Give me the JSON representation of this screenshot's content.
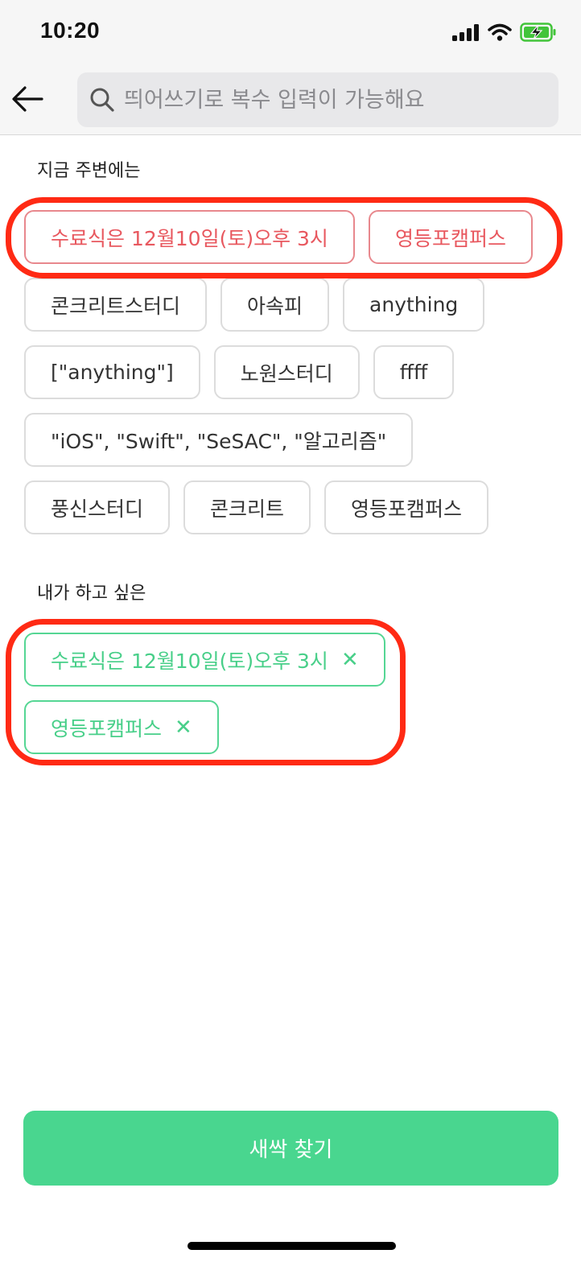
{
  "status_bar": {
    "time": "10:20",
    "icons": [
      "signal-icon",
      "wifi-icon",
      "battery-charging-icon"
    ],
    "battery_color": "#42c43a"
  },
  "nav": {
    "back_icon": "arrow-left-icon",
    "search_icon": "search-icon",
    "search_placeholder": "띄어쓰기로 복수 입력이 가능해요",
    "search_value": ""
  },
  "nearby": {
    "title": "지금 주변에는",
    "recommended": [
      {
        "label": "수료식은 12월10일(토)오후 3시"
      },
      {
        "label": "영등포캠퍼스"
      }
    ],
    "rows": [
      [
        {
          "label": "콘크리트스터디"
        },
        {
          "label": "아속피"
        },
        {
          "label": "anything"
        }
      ],
      [
        {
          "label": "[\"anything\"]"
        },
        {
          "label": "노원스터디"
        },
        {
          "label": "ffff"
        }
      ],
      [
        {
          "label": "\"iOS\", \"Swift\", \"SeSAC\", \"알고리즘\""
        }
      ],
      [
        {
          "label": "풍신스터디"
        },
        {
          "label": "콘크리트"
        },
        {
          "label": "영등포캠퍼스"
        }
      ]
    ]
  },
  "wanted": {
    "title": "내가 하고 싶은",
    "remove_symbol": "✕",
    "items": [
      {
        "label": "수료식은 12월10일(토)오후 3시"
      },
      {
        "label": "영등포캠퍼스"
      }
    ]
  },
  "find_button": {
    "label": "새싹 찾기"
  },
  "colors": {
    "accent_green": "#49d68f",
    "recommended_red": "#e8585f",
    "highlight_red": "#ff2a14",
    "tag_border": "#dcdcdc"
  }
}
